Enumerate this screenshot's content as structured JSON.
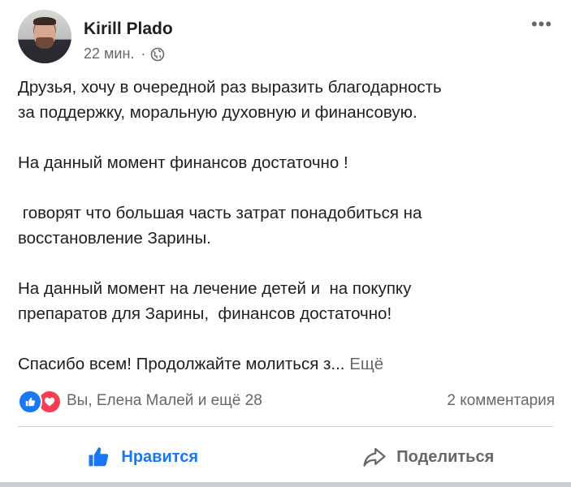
{
  "post": {
    "author": "Kirill Plado",
    "time": "22 мин.",
    "separator": "·",
    "privacy_icon": "globe-icon",
    "more_label": "•••",
    "paragraphs": [
      "Друзья, хочу в очередной раз выразить благодарность\nза поддержку, моральную духовную и финансовую.",
      "На данный момент финансов достаточно !",
      " говорят что большая часть затрат понадобиться на\nвосстановление Зарины.",
      "На данный момент на лечение детей и  на покупку\nпрепаратов для Зарины,  финансов достаточно!",
      "Спасибо всем! Продолжайте молиться з..."
    ],
    "see_more": "Ещё"
  },
  "reactions": {
    "icons": [
      "like-icon",
      "love-icon"
    ],
    "summary": "Вы, Елена Малей и ещё 28",
    "comments": "2 комментария"
  },
  "actions": {
    "like_label": "Нравится",
    "share_label": "Поделиться"
  },
  "colors": {
    "accent": "#1877f2",
    "love": "#f33e58",
    "muted": "#65676b"
  }
}
